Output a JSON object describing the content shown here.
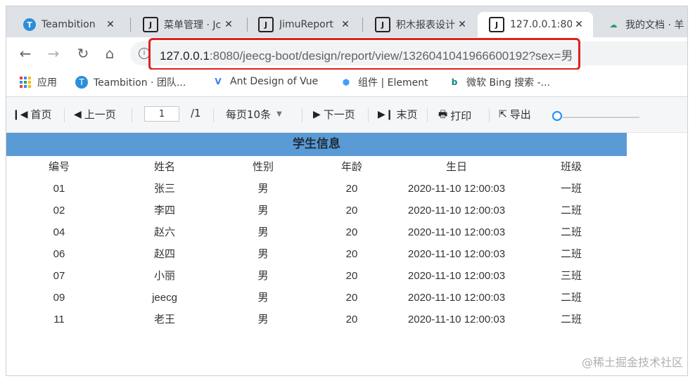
{
  "browser": {
    "tabs": [
      {
        "title": "Teambition",
        "favicon": "teambition-icon",
        "active": false
      },
      {
        "title": "菜单管理 · Jc",
        "favicon": "j-icon",
        "active": false
      },
      {
        "title": "JimuReport",
        "favicon": "j-icon",
        "active": false
      },
      {
        "title": "积木报表设计",
        "favicon": "j-icon",
        "active": false
      },
      {
        "title": "127.0.0.1:80",
        "favicon": "j-icon",
        "active": true
      },
      {
        "title": "我的文档 · 羊",
        "favicon": "doc-icon",
        "active": false
      }
    ],
    "close_glyph": "✕",
    "url_host": "127.0.0.1",
    "url_rest": ":8080/jeecg-boot/design/report/view/1326041041966600192?sex=男",
    "bookmarks": [
      {
        "label": "应用"
      },
      {
        "label": "Teambition · 团队..."
      },
      {
        "label": "Ant Design of Vue"
      },
      {
        "label": "组件 | Element"
      },
      {
        "label": "微软 Bing 搜索 -..."
      }
    ]
  },
  "viewer_toolbar": {
    "first_page": "首页",
    "prev_page": "上一页",
    "current_page": "1",
    "total_pages": "/1",
    "page_size": "每页10条",
    "next_page": "下一页",
    "last_page": "末页",
    "print": "打印",
    "export": "导出"
  },
  "report": {
    "title": "学生信息",
    "columns": [
      "编号",
      "姓名",
      "性别",
      "年龄",
      "生日",
      "班级"
    ],
    "rows": [
      [
        "01",
        "张三",
        "男",
        "20",
        "2020-11-10 12:00:03",
        "一班"
      ],
      [
        "02",
        "李四",
        "男",
        "20",
        "2020-11-10 12:00:03",
        "二班"
      ],
      [
        "04",
        "赵六",
        "男",
        "20",
        "2020-11-10 12:00:03",
        "二班"
      ],
      [
        "06",
        "赵四",
        "男",
        "20",
        "2020-11-10 12:00:03",
        "二班"
      ],
      [
        "07",
        "小丽",
        "男",
        "20",
        "2020-11-10 12:00:03",
        "三班"
      ],
      [
        "09",
        "jeecg",
        "男",
        "20",
        "2020-11-10 12:00:03",
        "二班"
      ],
      [
        "11",
        "老王",
        "男",
        "20",
        "2020-11-10 12:00:03",
        "二班"
      ]
    ]
  },
  "watermark": "@稀土掘金技术社区",
  "colors": {
    "report_header": "#5b9bd5",
    "highlight_border": "#e0201f",
    "slider_accent": "#1890ff"
  }
}
